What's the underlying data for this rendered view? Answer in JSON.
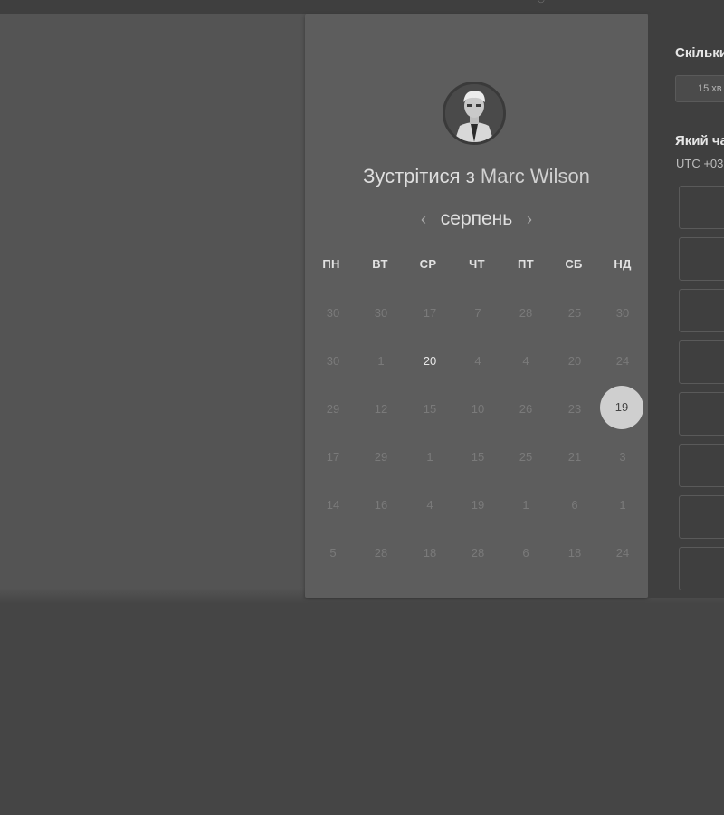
{
  "header": {
    "title_prefix": "Зустрітися з",
    "host_name": "Marc Wilson"
  },
  "calendar": {
    "month": "серпень",
    "prev_label": "‹",
    "next_label": "›",
    "weekdays": [
      "ПН",
      "ВТ",
      "СР",
      "ЧТ",
      "ПТ",
      "СБ",
      "НД"
    ],
    "weeks": [
      [
        "30",
        "30",
        "17",
        "7",
        "28",
        "25",
        "30"
      ],
      [
        "30",
        "1",
        "20",
        "4",
        "4",
        "20",
        "24"
      ],
      [
        "29",
        "12",
        "15",
        "10",
        "26",
        "23",
        "19"
      ],
      [
        "17",
        "29",
        "1",
        "15",
        "25",
        "21",
        "3"
      ],
      [
        "14",
        "16",
        "4",
        "19",
        "1",
        "6",
        "1"
      ],
      [
        "5",
        "28",
        "18",
        "28",
        "6",
        "18",
        "24"
      ]
    ],
    "available_day": "20",
    "selected_day": "19"
  },
  "side": {
    "duration_label": "Скільки",
    "duration_value": "15 хв",
    "time_label": "Який ча",
    "timezone": "UTC +03"
  },
  "colors": {
    "background": "#454545",
    "panel": "#5d5d5d",
    "selected_circle": "#cfcfcf"
  },
  "icons": {
    "month_prev": "chevron-left-icon",
    "month_next": "chevron-right-icon"
  }
}
